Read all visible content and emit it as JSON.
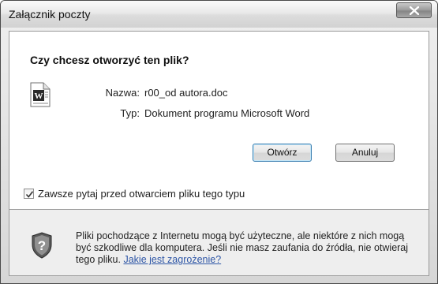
{
  "window": {
    "title": "Załącznik poczty"
  },
  "question": "Czy chcesz otworzyć ten plik?",
  "file": {
    "name_label": "Nazwa:",
    "name_value": "r00_od autora.doc",
    "type_label": "Typ:",
    "type_value": "Dokument programu Microsoft Word",
    "icon": "word-document-icon"
  },
  "buttons": {
    "open": "Otwórz",
    "cancel": "Anuluj"
  },
  "checkbox": {
    "label": "Zawsze pytaj przed otwarciem pliku tego typu",
    "checked": true
  },
  "warning": {
    "text": "Pliki pochodzące z Internetu mogą być użyteczne, ale niektóre z nich mogą być szkodliwe dla komputera. Jeśli nie masz zaufania do źródła, nie otwieraj tego pliku.",
    "link": "Jakie jest zagrożenie?",
    "icon": "security-shield-icon"
  },
  "colors": {
    "link": "#2e56a6",
    "default_button_border": "#3c7fb1"
  }
}
